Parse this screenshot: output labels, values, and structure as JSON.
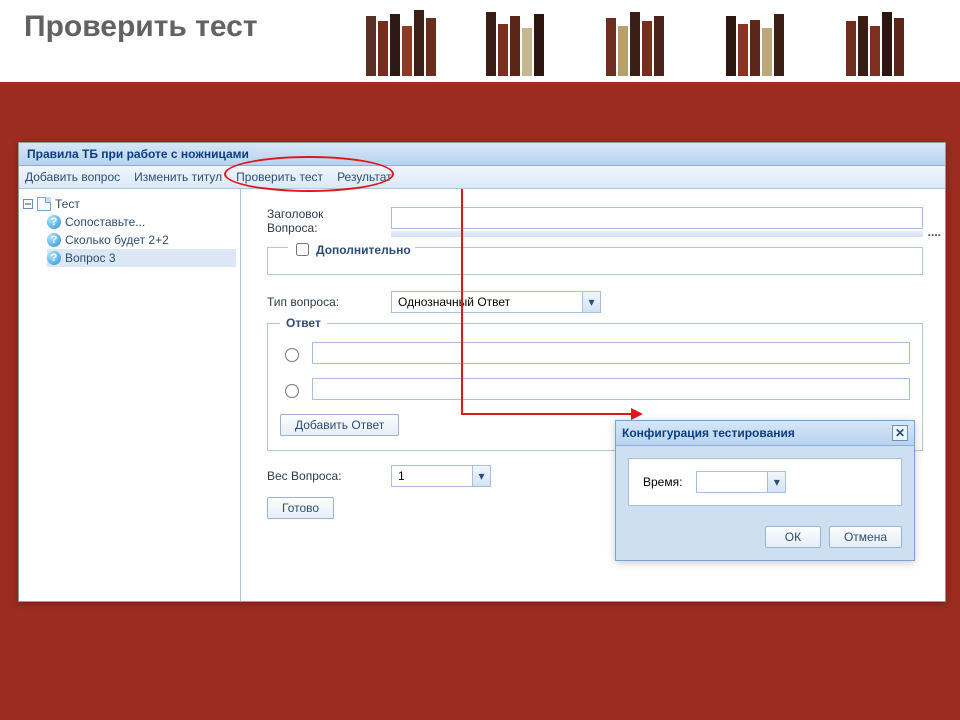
{
  "page": {
    "title": "Проверить тест"
  },
  "window": {
    "title": "Правила ТБ при работе с ножницами"
  },
  "toolbar": {
    "add_question": "Добавить вопрос",
    "edit_title": "Изменить титул",
    "check_test": "Проверить тест",
    "result": "Результат"
  },
  "tree": {
    "root": "Тест",
    "items": [
      "Сопоставьте...",
      "Сколько будет 2+2",
      "Вопрос 3"
    ],
    "selected_index": 2
  },
  "form": {
    "headline_label_line1": "Заголовок",
    "headline_label_line2": "Вопроса:",
    "headline_value": "",
    "headline_hint": "....",
    "additional_label": "Дополнительно",
    "additional_checked": false,
    "type_label": "Тип вопроса:",
    "type_value": "Однозначный Ответ",
    "answers_caption": "Ответ",
    "answers": [
      "",
      ""
    ],
    "add_answer_button": "Добавить Ответ",
    "weight_label": "Вес Вопроса:",
    "weight_value": "1",
    "done_button": "Готово"
  },
  "dialog": {
    "title": "Конфигурация тестирования",
    "time_label": "Время:",
    "time_value": "",
    "ok": "ОК",
    "cancel": "Отмена"
  }
}
